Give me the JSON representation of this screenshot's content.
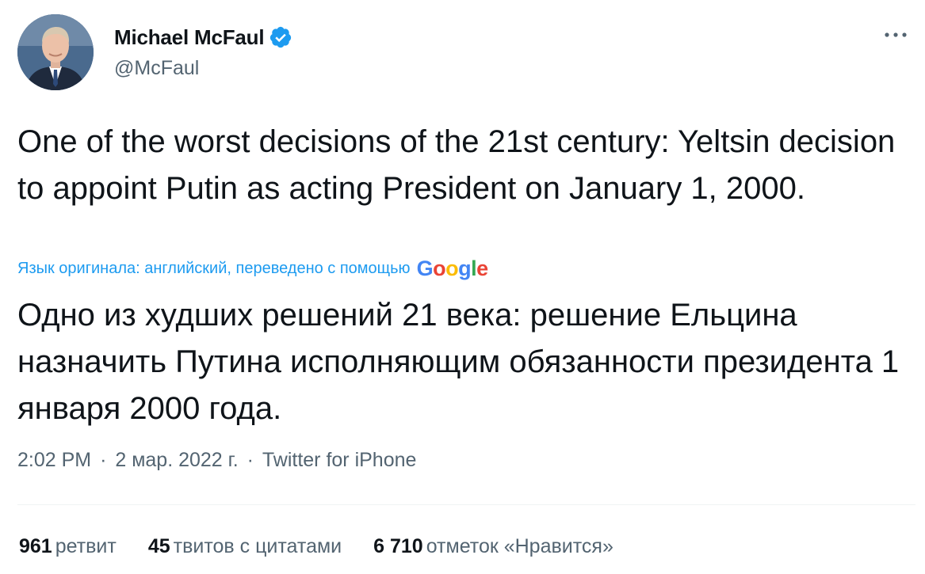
{
  "author": {
    "name": "Michael McFaul",
    "handle": "@McFaul",
    "verified": true,
    "avatar_icon": "avatar-photo",
    "verified_color": "#1d9bf0"
  },
  "tweet": {
    "text": "One of the worst decisions of the 21st century: Yeltsin decision to appoint Putin as acting President on January 1, 2000.",
    "translation_note": "Язык оригинала: английский, переведено с помощью",
    "translation_provider": [
      "G",
      "o",
      "o",
      "g",
      "l",
      "e"
    ],
    "translated_text": "Одно из худших решений 21 века: решение Ельцина назначить Путина исполняющим обязанности президента 1 января 2000 года."
  },
  "meta": {
    "time": "2:02 PM",
    "separator": "·",
    "date": "2 мар. 2022 г.",
    "source": "Twitter for iPhone"
  },
  "stats": {
    "retweets": {
      "count": "961",
      "label": "ретвит"
    },
    "quotes": {
      "count": "45",
      "label": "твитов с цитатами"
    },
    "likes": {
      "count": "6 710",
      "label": "отметок «Нравится»"
    }
  },
  "colors": {
    "text": "#0f1419",
    "secondary": "#536471",
    "link": "#1d9bf0",
    "divider": "#eff3f4"
  }
}
